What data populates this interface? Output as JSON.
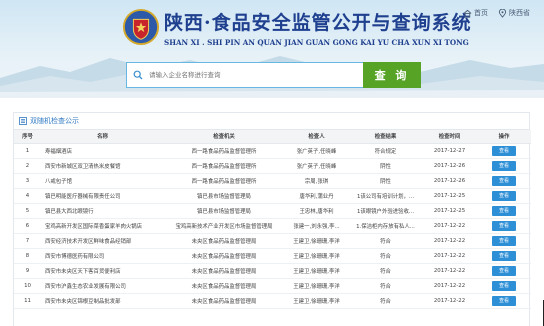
{
  "header": {
    "title_cn": "陕西·食品安全监管公开与查询系统",
    "title_en": "SHAN XI . SHI PIN AN QUAN JIAN GUAN GONG KAI YU CHA XUN XI TONG",
    "links": [
      {
        "label": "首页",
        "icon": "home-icon"
      },
      {
        "label": "陕西省",
        "icon": "location-pin-icon"
      }
    ],
    "colors": {
      "title": "#1f3f8f",
      "sky": "#cfe6f4"
    }
  },
  "search": {
    "placeholder": "请输入企业名称进行查询",
    "button_label": "查 询",
    "button_color": "#57a326"
  },
  "panel": {
    "title": "双随机检查公示",
    "columns": [
      "序号",
      "名称",
      "检查机关",
      "检查人",
      "检查结果",
      "检查时间",
      "操作"
    ],
    "rows": [
      {
        "no": "1",
        "name": "寿福烟酒店",
        "org": "西一路食品药品监督管理所",
        "inspector": "张广英子,任晓峰",
        "result": "符合规定",
        "date": "2017-12-27",
        "action": "查看"
      },
      {
        "no": "2",
        "name": "西安市新城区双卫清热米皮餐馆",
        "org": "西一路食品药品监督管理所",
        "inspector": "张广英子,任晓峰",
        "result": "阴性",
        "date": "2017-12-26",
        "action": "查看"
      },
      {
        "no": "3",
        "name": "八戒包子馆",
        "org": "西一路食品药品监督管理所",
        "inspector": "宗周,张琪",
        "result": "阴性",
        "date": "2017-12-26",
        "action": "查看"
      },
      {
        "no": "4",
        "name": "镇巴明能医疗器械有限责任公司",
        "org": "镇巴县市场监督管理局",
        "inspector": "唐华利,蒲业丹",
        "result": "1该公司有培训计划，...",
        "date": "2017-12-25",
        "action": "查看"
      },
      {
        "no": "5",
        "name": "镇巴县大西北眼镜行",
        "org": "镇巴县市场监督管理局",
        "inspector": "王忠林,唐华利",
        "result": "1该眼镜户外验进验收...",
        "date": "2017-12-25",
        "action": "查看"
      },
      {
        "no": "6",
        "name": "宝鸡高新开发区国际菜香蛋家羊肉火锅店",
        "org": "宝鸡高新技术产业开发区市场监督管理局",
        "inspector": "张建一,刘永强,李...",
        "result": "1.保洁柜内存放有私人...",
        "date": "2017-12-22",
        "action": "查看"
      },
      {
        "no": "7",
        "name": "西安经济技术开发区鲜味食品经销部",
        "org": "未央区食品药品监督管理局",
        "inspector": "王建卫,徐珊珊,李洋",
        "result": "符合",
        "date": "2017-12-22",
        "action": "查看"
      },
      {
        "no": "8",
        "name": "西安市博德医药有限公司",
        "org": "未央区食品药品监督管理局",
        "inspector": "王建卫,徐珊珊,李洋",
        "result": "符合",
        "date": "2017-12-22",
        "action": "查看"
      },
      {
        "no": "9",
        "name": "西安市未央区天下客百货便利店",
        "org": "未央区食品药品监督管理局",
        "inspector": "王建卫,徐珊珊,李洋",
        "result": "符合",
        "date": "2017-12-22",
        "action": "查看"
      },
      {
        "no": "10",
        "name": "西安市沪鑫生态农业发展有限公司",
        "org": "未央区食品药品监督管理局",
        "inspector": "王建卫,徐珊珊,李洋",
        "result": "符合",
        "date": "2017-12-22",
        "action": "查看"
      },
      {
        "no": "11",
        "name": "西安市未央区锦根豆制品批发部",
        "org": "未央区食品药品监督管理局",
        "inspector": "王建卫,徐珊珊,李洋",
        "result": "符合",
        "date": "2017-12-22",
        "action": "查看"
      }
    ]
  }
}
